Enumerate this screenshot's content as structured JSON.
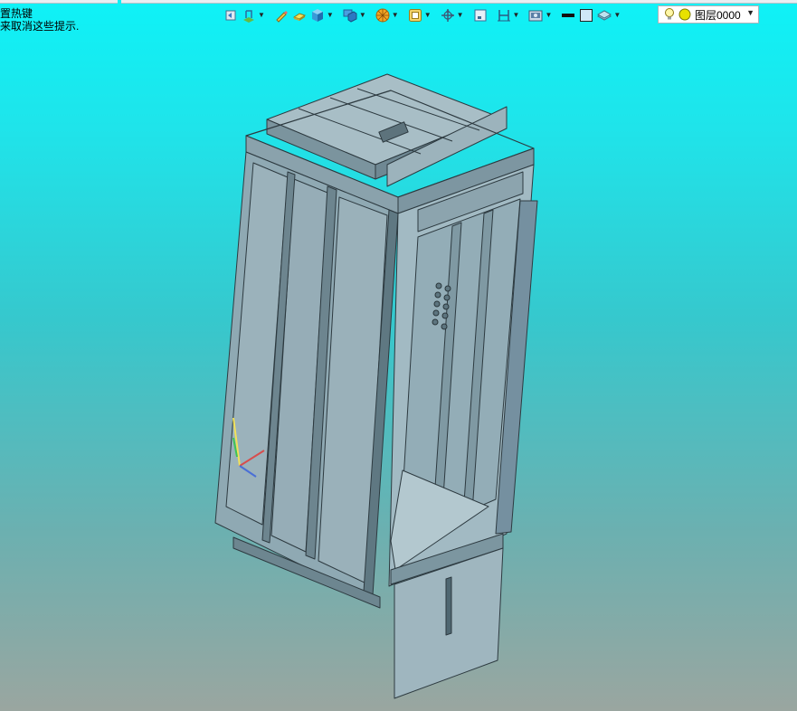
{
  "hint": {
    "line1": "置热键",
    "line2": "来取消这些提示."
  },
  "toolbar": {
    "icons": [
      "view-back-icon",
      "scene-layer-icon",
      "pencil-icon",
      "eraser-icon",
      "cube-shaded-icon",
      "display-mode-icon",
      "render-ball-icon",
      "snap-icon",
      "orbit-axes-icon",
      "frame-view-icon",
      "section-plane-icon",
      "camera-settings-icon",
      "line-color-icon",
      "fill-color-icon",
      "layers-stack-icon"
    ]
  },
  "layer": {
    "name": "图层0000"
  },
  "colors": {
    "bg_top": "#0ef2f7",
    "bg_bottom": "#9aa6a0",
    "part_fill": "#8fa9b3",
    "part_stroke": "#2d3a40"
  }
}
